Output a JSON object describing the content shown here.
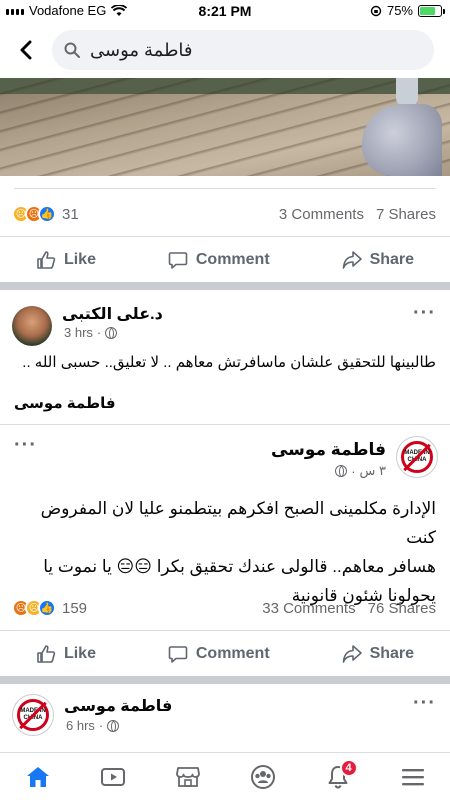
{
  "status_bar": {
    "carrier": "Vodafone EG",
    "time": "8:21 PM",
    "battery": "75%",
    "battery_level": 0.75
  },
  "search": {
    "query": "فاطمة موسى"
  },
  "post1": {
    "reaction_count": "31",
    "comments": "3 Comments",
    "shares": "7 Shares",
    "actions": {
      "like": "Like",
      "comment": "Comment",
      "share": "Share"
    }
  },
  "post2": {
    "author": "د.على الكتبى",
    "time": "3 hrs",
    "text": "طالبينها للتحقيق علشان ماسافرتش معاهم .. لا تعليق.. حسبى الله ..",
    "shared_from": "فاطمة موسى"
  },
  "post3": {
    "author": "فاطمة موسى",
    "time": "٣ س",
    "avatar_text": "MADE IN CHINA",
    "text_line1": "الإدارة مكلمينى الصبح افكرهم بيتطمنو عليا لان المفروض كنت",
    "text_line2": "هسافر معاهم.. قالولى عندك تحقيق بكرا 😑😑 يا نموت يا",
    "text_line3": "يحولونا شئون قانونية",
    "reaction_count": "159",
    "comments": "33 Comments",
    "shares": "76 Shares",
    "actions": {
      "like": "Like",
      "comment": "Comment",
      "share": "Share"
    }
  },
  "post4": {
    "author": "فاطمة موسى",
    "time": "6 hrs",
    "avatar_text": "MADE IN CHINA"
  },
  "nav": {
    "notifications_badge": "4",
    "active_color": "#1877f2"
  }
}
